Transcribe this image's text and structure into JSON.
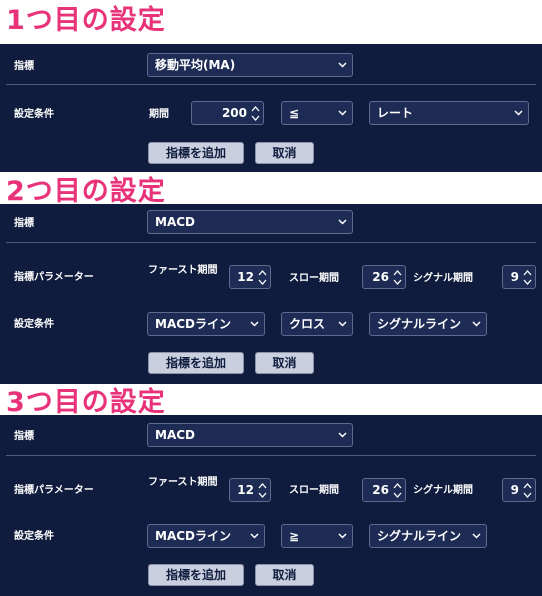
{
  "sections": [
    {
      "heading": "1つ目の設定",
      "indicator_label": "指標",
      "indicator_value": "移動平均(MA)",
      "condition_label": "設定条件",
      "period_label": "期間",
      "period_value": "200",
      "operator": "≦",
      "target": "レート",
      "add_button": "指標を追加",
      "cancel_button": "取消"
    },
    {
      "heading": "2つ目の設定",
      "indicator_label": "指標",
      "indicator_value": "MACD",
      "params_label": "指標パラメーター",
      "fast_label": "ファースト期間",
      "fast_value": "12",
      "slow_label": "スロー期間",
      "slow_value": "26",
      "signal_label": "シグナル期間",
      "signal_value": "9",
      "condition_label": "設定条件",
      "line_value": "MACDライン",
      "operator": "クロス",
      "target": "シグナルライン",
      "add_button": "指標を追加",
      "cancel_button": "取消"
    },
    {
      "heading": "3つ目の設定",
      "indicator_label": "指標",
      "indicator_value": "MACD",
      "params_label": "指標パラメーター",
      "fast_label": "ファースト期間",
      "fast_value": "12",
      "slow_label": "スロー期間",
      "slow_value": "26",
      "signal_label": "シグナル期間",
      "signal_value": "9",
      "condition_label": "設定条件",
      "line_value": "MACDライン",
      "operator": "≧",
      "target": "シグナルライン",
      "add_button": "指標を追加",
      "cancel_button": "取消"
    }
  ],
  "colors": {
    "panel": "#0f1c3d",
    "heading": "#e8337a",
    "button": "#c9cfdf"
  },
  "icons": {
    "dropdown": "chevron-down-icon",
    "spinner": "spin-arrows-icon"
  }
}
